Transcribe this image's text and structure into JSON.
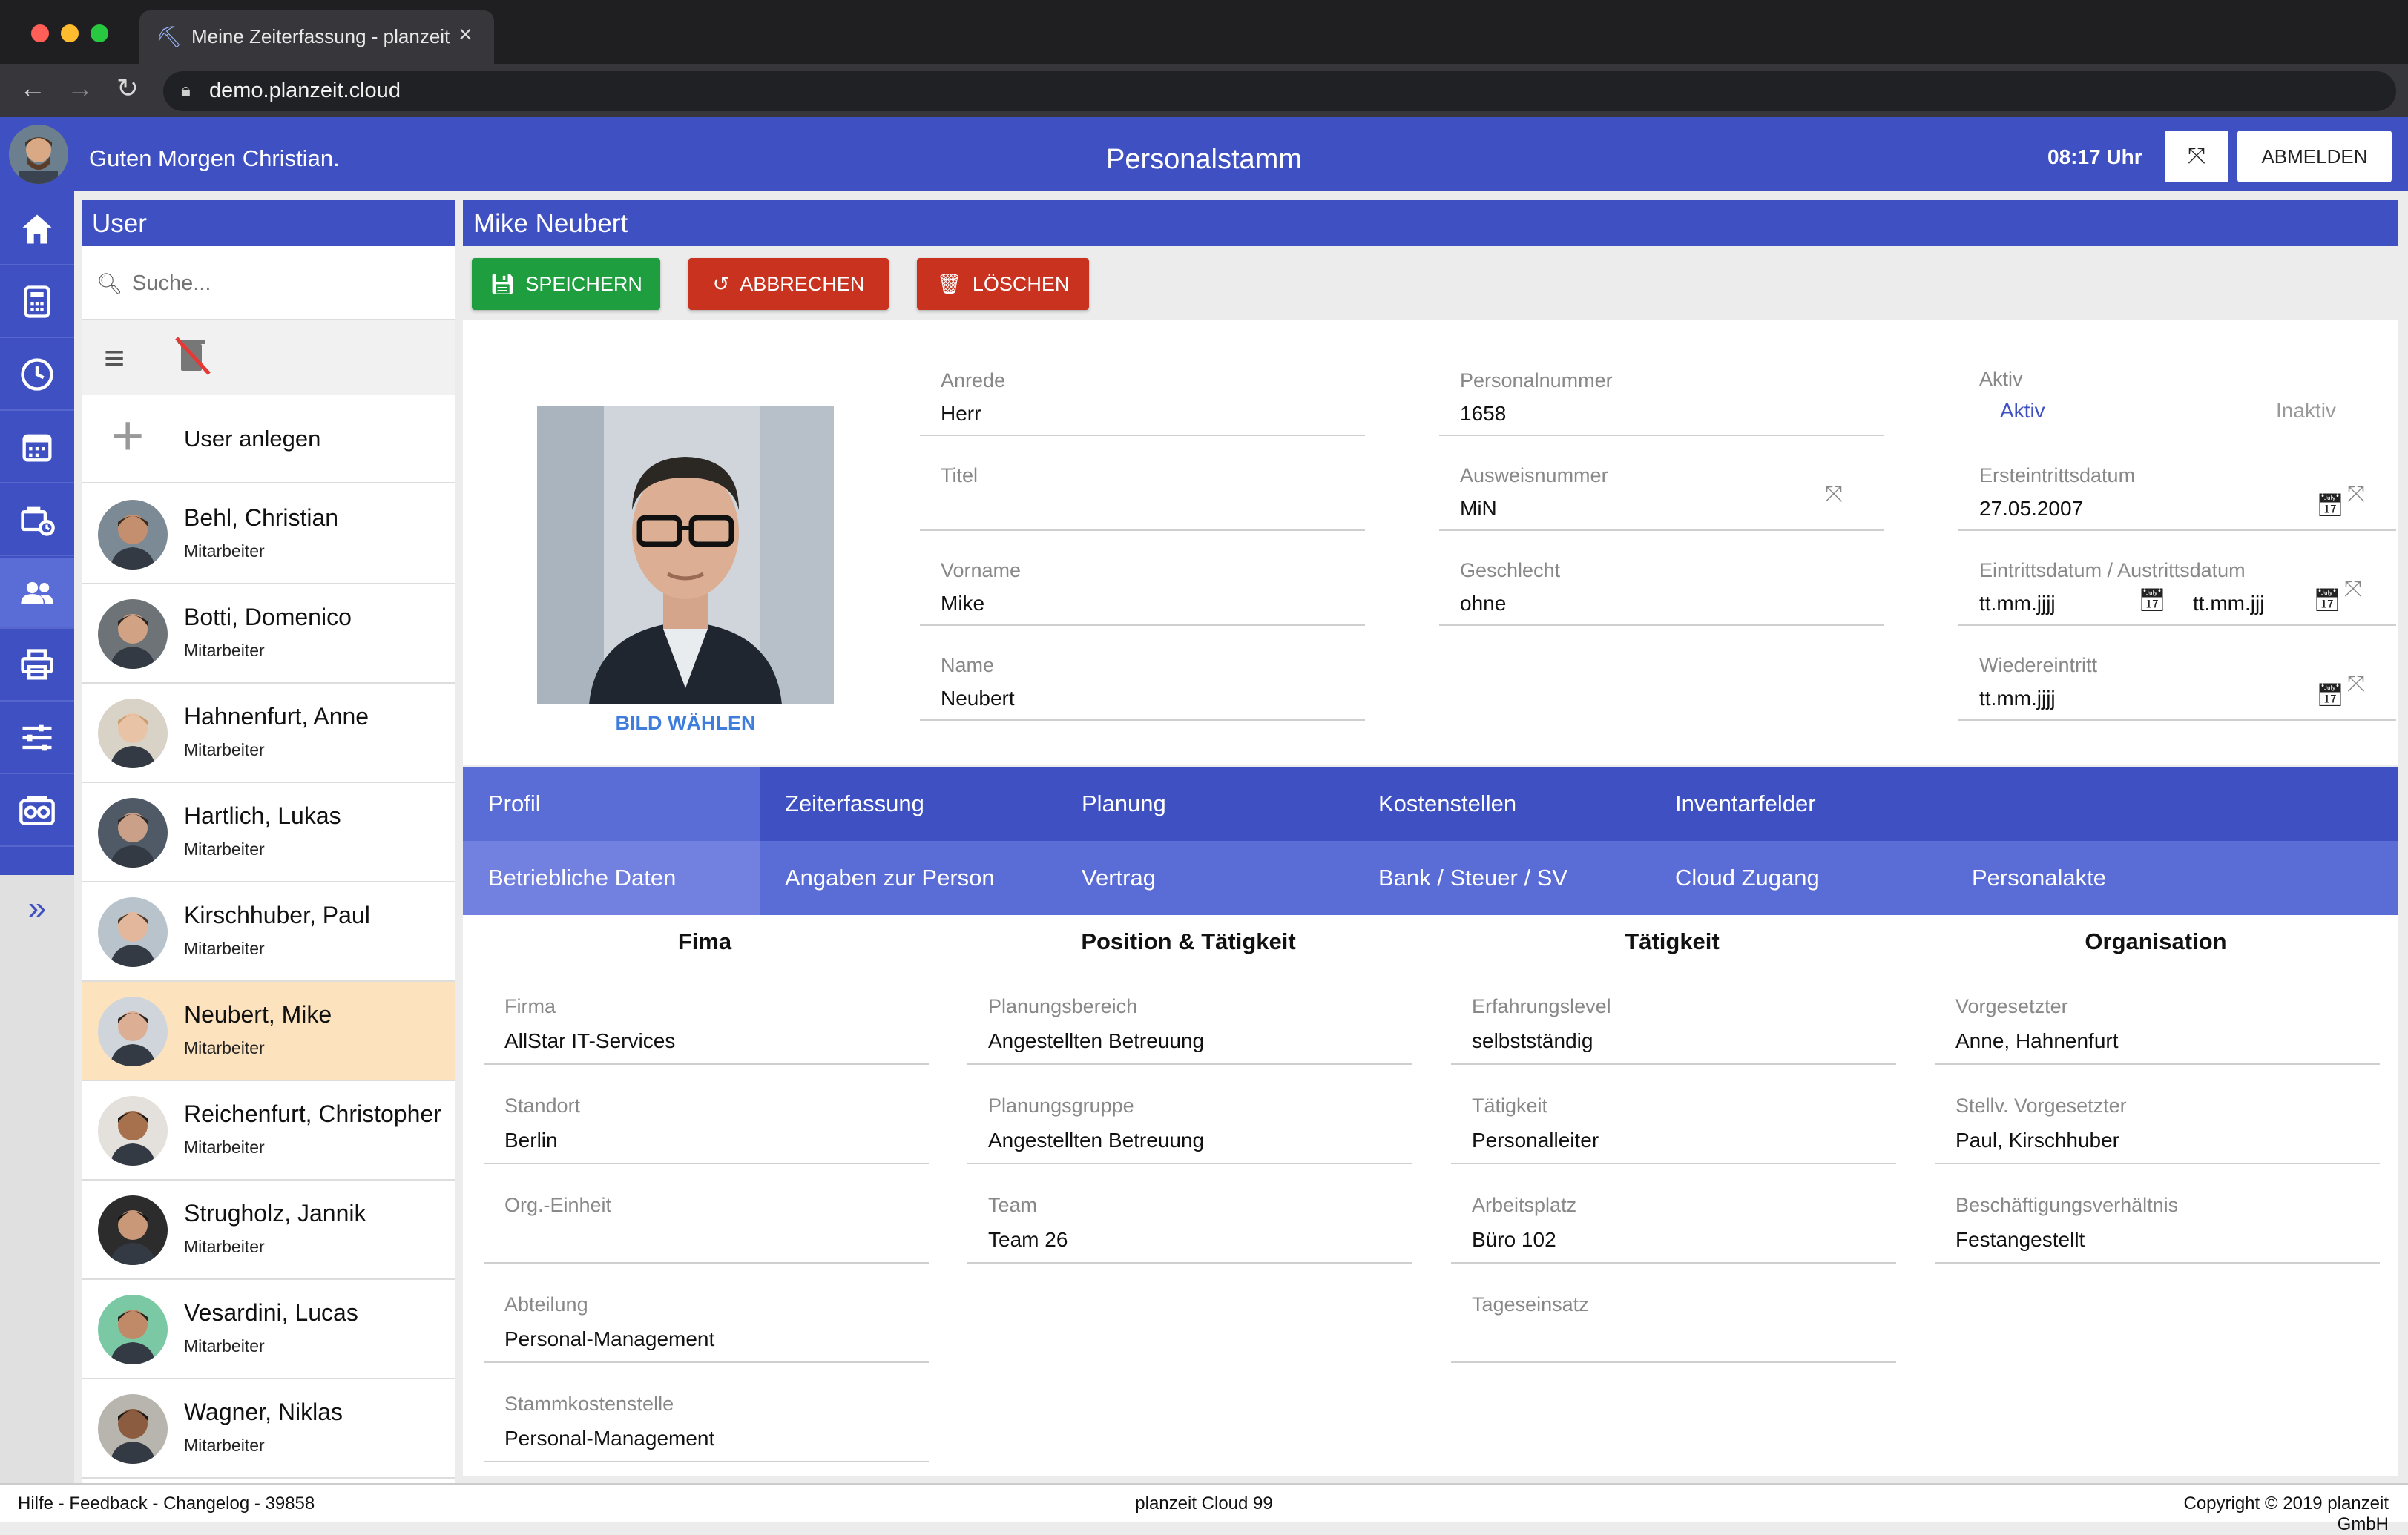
{
  "browser": {
    "tab_title": "Meine Zeiterfassung - planzeit",
    "url": "demo.planzeit.cloud"
  },
  "header": {
    "greeting": "Guten Morgen Christian.",
    "title": "Personalstamm",
    "clock": "08:17 Uhr",
    "logout_label": "ABMELDEN"
  },
  "user_panel": {
    "title": "User",
    "search_placeholder": "Suche...",
    "add_label": "User anlegen",
    "users": [
      {
        "name": "Behl, Christian",
        "role": "Mitarbeiter"
      },
      {
        "name": "Botti, Domenico",
        "role": "Mitarbeiter"
      },
      {
        "name": "Hahnenfurt, Anne",
        "role": "Mitarbeiter"
      },
      {
        "name": "Hartlich, Lukas",
        "role": "Mitarbeiter"
      },
      {
        "name": "Kirschhuber, Paul",
        "role": "Mitarbeiter"
      },
      {
        "name": "Neubert, Mike",
        "role": "Mitarbeiter"
      },
      {
        "name": "Reichenfurt, Christopher",
        "role": "Mitarbeiter"
      },
      {
        "name": "Strugholz, Jannik",
        "role": "Mitarbeiter"
      },
      {
        "name": "Vesardini, Lucas",
        "role": "Mitarbeiter"
      },
      {
        "name": "Wagner, Niklas",
        "role": "Mitarbeiter"
      }
    ]
  },
  "main": {
    "title": "Mike Neubert",
    "actions": {
      "save": "SPEICHERN",
      "cancel": "ABBRECHEN",
      "delete": "LÖSCHEN"
    },
    "choose_picture": "BILD WÄHLEN",
    "fields": {
      "anrede": {
        "label": "Anrede",
        "value": "Herr"
      },
      "titel": {
        "label": "Titel",
        "value": ""
      },
      "vorname": {
        "label": "Vorname",
        "value": "Mike"
      },
      "name": {
        "label": "Name",
        "value": "Neubert"
      },
      "personalnummer": {
        "label": "Personalnummer",
        "value": "1658"
      },
      "ausweisnummer": {
        "label": "Ausweisnummer",
        "value": "MiN"
      },
      "geschlecht": {
        "label": "Geschlecht",
        "value": "ohne"
      },
      "aktiv": {
        "label": "Aktiv",
        "on": "Aktiv",
        "off": "Inaktiv"
      },
      "ersteintritt": {
        "label": "Ersteintrittsdatum",
        "value": "27.05.2007"
      },
      "eintritt_austritt": {
        "label": "Eintrittsdatum / Austrittsdatum",
        "value1": "tt.mm.jjjj",
        "value2": "tt.mm.jjj"
      },
      "wiedereintritt": {
        "label": "Wiedereintritt",
        "value": "tt.mm.jjjj"
      }
    },
    "tabs_row1": [
      "Profil",
      "Zeiterfassung",
      "Planung",
      "Kostenstellen",
      "Inventarfelder"
    ],
    "tabs_row2": [
      "Betriebliche Daten",
      "Angaben zur Person",
      "Vertrag",
      "Bank / Steuer / SV",
      "Cloud Zugang",
      "Personalakte"
    ],
    "columns": [
      {
        "heading": "Fima",
        "fields": [
          {
            "label": "Firma",
            "value": "AllStar IT-Services"
          },
          {
            "label": "Standort",
            "value": "Berlin"
          },
          {
            "label": "Org.-Einheit",
            "value": ""
          },
          {
            "label": "Abteilung",
            "value": "Personal-Management"
          },
          {
            "label": "Stammkostenstelle",
            "value": "Personal-Management"
          }
        ]
      },
      {
        "heading": "Position & Tätigkeit",
        "fields": [
          {
            "label": "Planungsbereich",
            "value": "Angestellten Betreuung"
          },
          {
            "label": "Planungsgruppe",
            "value": "Angestellten Betreuung"
          },
          {
            "label": "Team",
            "value": "Team 26"
          }
        ]
      },
      {
        "heading": "Tätigkeit",
        "fields": [
          {
            "label": "Erfahrungslevel",
            "value": "selbstständig"
          },
          {
            "label": "Tätigkeit",
            "value": "Personalleiter"
          },
          {
            "label": "Arbeitsplatz",
            "value": "Büro 102"
          },
          {
            "label": "Tageseinsatz",
            "value": ""
          }
        ]
      },
      {
        "heading": "Organisation",
        "fields": [
          {
            "label": "Vorgesetzter",
            "value": "Anne, Hahnenfurt"
          },
          {
            "label": "Stellv. Vorgesetzter",
            "value": "Paul, Kirschhuber"
          },
          {
            "label": "Beschäftigungsverhältnis",
            "value": "Festangestellt"
          }
        ]
      }
    ]
  },
  "footer": {
    "left": "Hilfe - Feedback - Changelog - 39858",
    "center": "planzeit Cloud 99",
    "right": "Copyright © 2019 planzeit GmbH"
  },
  "colors": {
    "brand": "#3f51c2",
    "save": "#1e9e3e",
    "cancel": "#c9321f",
    "delete": "#c9321f",
    "selected_row": "#fde2be"
  }
}
